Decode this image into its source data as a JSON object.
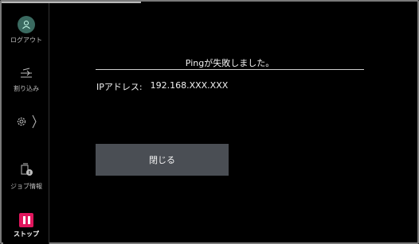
{
  "sidebar": {
    "logout_label": "ログアウト",
    "interrupt_label": "割り込み",
    "jobinfo_label": "ジョブ情報",
    "stop_label": "ストップ"
  },
  "dialog": {
    "title": "Pingが失敗しました。",
    "ip_label": "IPアドレス:",
    "ip_value": "192.168.XXX.XXX",
    "close_label": "閉じる"
  },
  "colors": {
    "stop_accent": "#e0165d",
    "avatar": "#3a6a60",
    "button_bg": "#4a4e54"
  },
  "icons": [
    "user-icon",
    "interrupt-icon",
    "gear-icon",
    "chevron-right-icon",
    "job-info-icon",
    "stop-icon"
  ]
}
